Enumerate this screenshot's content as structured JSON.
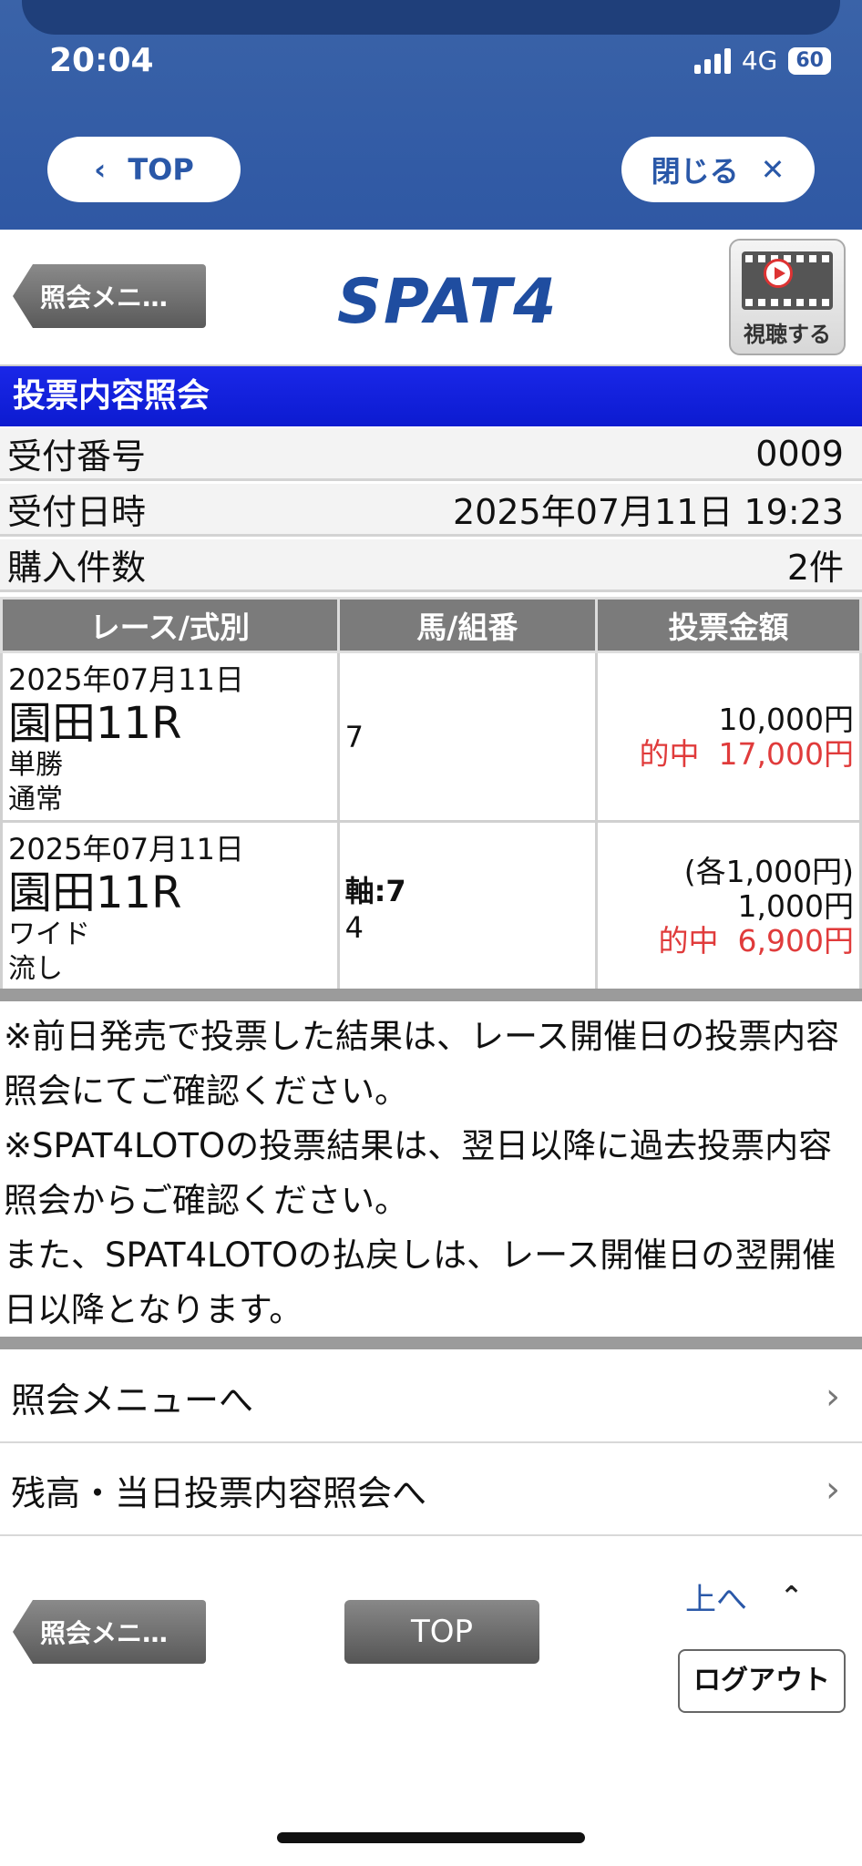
{
  "status": {
    "time": "20:04",
    "network": "4G",
    "battery": "60"
  },
  "nav": {
    "top_label": "TOP",
    "close_label": "閉じる"
  },
  "header": {
    "back_label": "照会メニ…",
    "logo": "SPAT4",
    "video_label": "視聴する"
  },
  "title": "投票内容照会",
  "info": [
    {
      "label": "受付番号",
      "value": "0009"
    },
    {
      "label": "受付日時",
      "value": "2025年07月11日 19:23"
    },
    {
      "label": "購入件数",
      "value": "2件"
    }
  ],
  "table": {
    "headers": [
      "レース/式別",
      "馬/組番",
      "投票金額"
    ],
    "rows": [
      {
        "date": "2025年07月11日",
        "race": "園田11R",
        "type": "単勝",
        "method": "通常",
        "combo_main": "",
        "combo_sub": "7",
        "amount_each": "",
        "amount": "10,000円",
        "hit_label": "的中",
        "hit_amount": "17,000円"
      },
      {
        "date": "2025年07月11日",
        "race": "園田11R",
        "type": "ワイド",
        "method": "流し",
        "combo_main": "軸:7",
        "combo_sub": "4",
        "amount_each": "(各1,000円)",
        "amount": "1,000円",
        "hit_label": "的中",
        "hit_amount": "6,900円"
      }
    ]
  },
  "notes": [
    "※前日発売で投票した結果は、レース開催日の投票内容照会にてご確認ください。",
    "※SPAT4LOTOの投票結果は、翌日以降に過去投票内容照会からご確認ください。",
    "また、SPAT4LOTOの払戻しは、レース開催日の翌開催日以降となります。"
  ],
  "menu": [
    {
      "label": "照会メニューへ"
    },
    {
      "label": "残高・当日投票内容照会へ"
    }
  ],
  "footer": {
    "back_label": "照会メニ…",
    "top_label": "TOP",
    "up_label": "上へ",
    "logout_label": "ログアウト"
  },
  "colors": {
    "title_bar": "#0c1bd0",
    "hit": "#e03b3b",
    "brand": "#1f4da0",
    "topbar": "#2f58a4"
  }
}
